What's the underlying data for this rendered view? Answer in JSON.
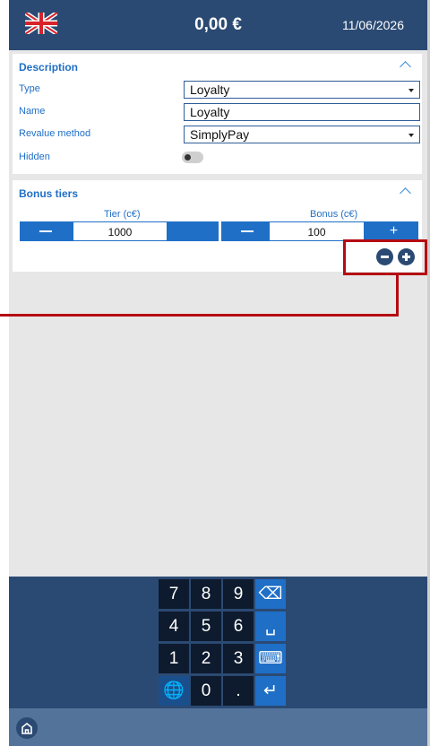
{
  "header": {
    "flag_icon": "uk-flag-icon",
    "balance": "0,00 €",
    "date": "11/06/2026"
  },
  "description": {
    "title": "Description",
    "type_label": "Type",
    "type_value": "Loyalty",
    "name_label": "Name",
    "name_value": "Loyalty",
    "revalue_label": "Revalue method",
    "revalue_value": "SimplyPay",
    "hidden_label": "Hidden",
    "hidden_on": false
  },
  "bonus_tiers": {
    "title": "Bonus tiers",
    "tier_header": "Tier (c€)",
    "bonus_header": "Bonus (c€)",
    "tier_value": "1000",
    "bonus_value": "100",
    "add_label": "+"
  },
  "keypad": {
    "rows": [
      [
        "7",
        "8",
        "9",
        "⌫"
      ],
      [
        "4",
        "5",
        "6",
        "␣"
      ],
      [
        "1",
        "2",
        "3",
        "⌨"
      ],
      [
        "🌐",
        "0",
        ".",
        "↵"
      ]
    ]
  },
  "colors": {
    "header": "#2b4a73",
    "accent": "#1f6fc7",
    "annotation": "#b40b12"
  }
}
